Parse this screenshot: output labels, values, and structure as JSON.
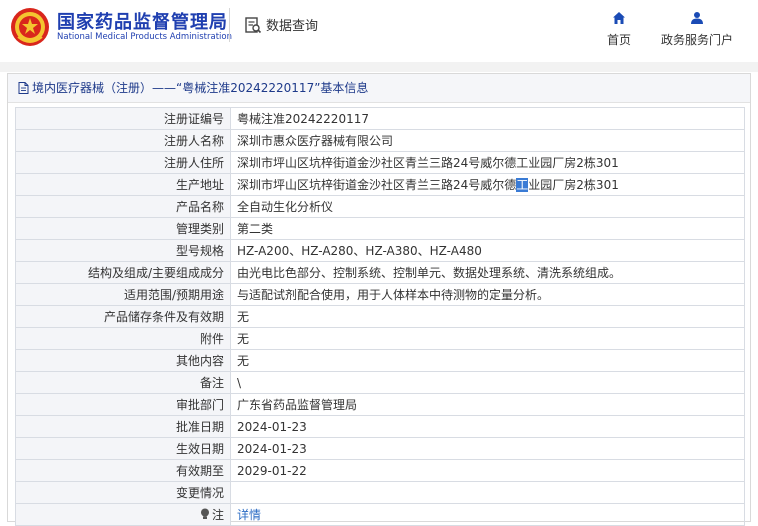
{
  "header": {
    "brand_cn": "国家药品监督管理局",
    "brand_en": "National Medical Products Administration",
    "query_label": "数据查询",
    "nav": [
      {
        "label": "首页",
        "icon": "home-icon"
      },
      {
        "label": "政务服务门户",
        "icon": "user-icon"
      }
    ],
    "accent_color": "#1f3fb0",
    "nav_icon_color": "#1a4bb5"
  },
  "panel": {
    "title": "境内医疗器械（注册）——“粤械注准20242220117”基本信息"
  },
  "rows": [
    {
      "key": "注册证编号",
      "value": "粤械注准20242220117"
    },
    {
      "key": "注册人名称",
      "value": "深圳市惠众医疗器械有限公司"
    },
    {
      "key": "注册人住所",
      "value": "深圳市坪山区坑梓街道金沙社区青兰三路24号威尔德工业园厂房2栋301"
    },
    {
      "key": "生产地址",
      "value_pre": "深圳市坪山区坑梓街道金沙社区青兰三路24号威尔德",
      "value_hl": "工",
      "value_post": "业园厂房2栋301"
    },
    {
      "key": "产品名称",
      "value": "全自动生化分析仪"
    },
    {
      "key": "管理类别",
      "value": "第二类"
    },
    {
      "key": "型号规格",
      "value": "HZ-A200、HZ-A280、HZ-A380、HZ-A480"
    },
    {
      "key": "结构及组成/主要组成成分",
      "value": "由光电比色部分、控制系统、控制单元、数据处理系统、清洗系统组成。"
    },
    {
      "key": "适用范围/预期用途",
      "value": "与适配试剂配合使用，用于人体样本中待测物的定量分析。"
    },
    {
      "key": "产品储存条件及有效期",
      "value": "无"
    },
    {
      "key": "附件",
      "value": "无"
    },
    {
      "key": "其他内容",
      "value": "无"
    },
    {
      "key": "备注",
      "value": "\\"
    },
    {
      "key": "审批部门",
      "value": "广东省药品监督管理局"
    },
    {
      "key": "批准日期",
      "value": "2024-01-23"
    },
    {
      "key": "生效日期",
      "value": "2024-01-23"
    },
    {
      "key": "有效期至",
      "value": "2029-01-22"
    },
    {
      "key": "变更情况",
      "value": ""
    },
    {
      "key": "注",
      "icon": "lightbulb-icon",
      "link": "详情"
    }
  ]
}
